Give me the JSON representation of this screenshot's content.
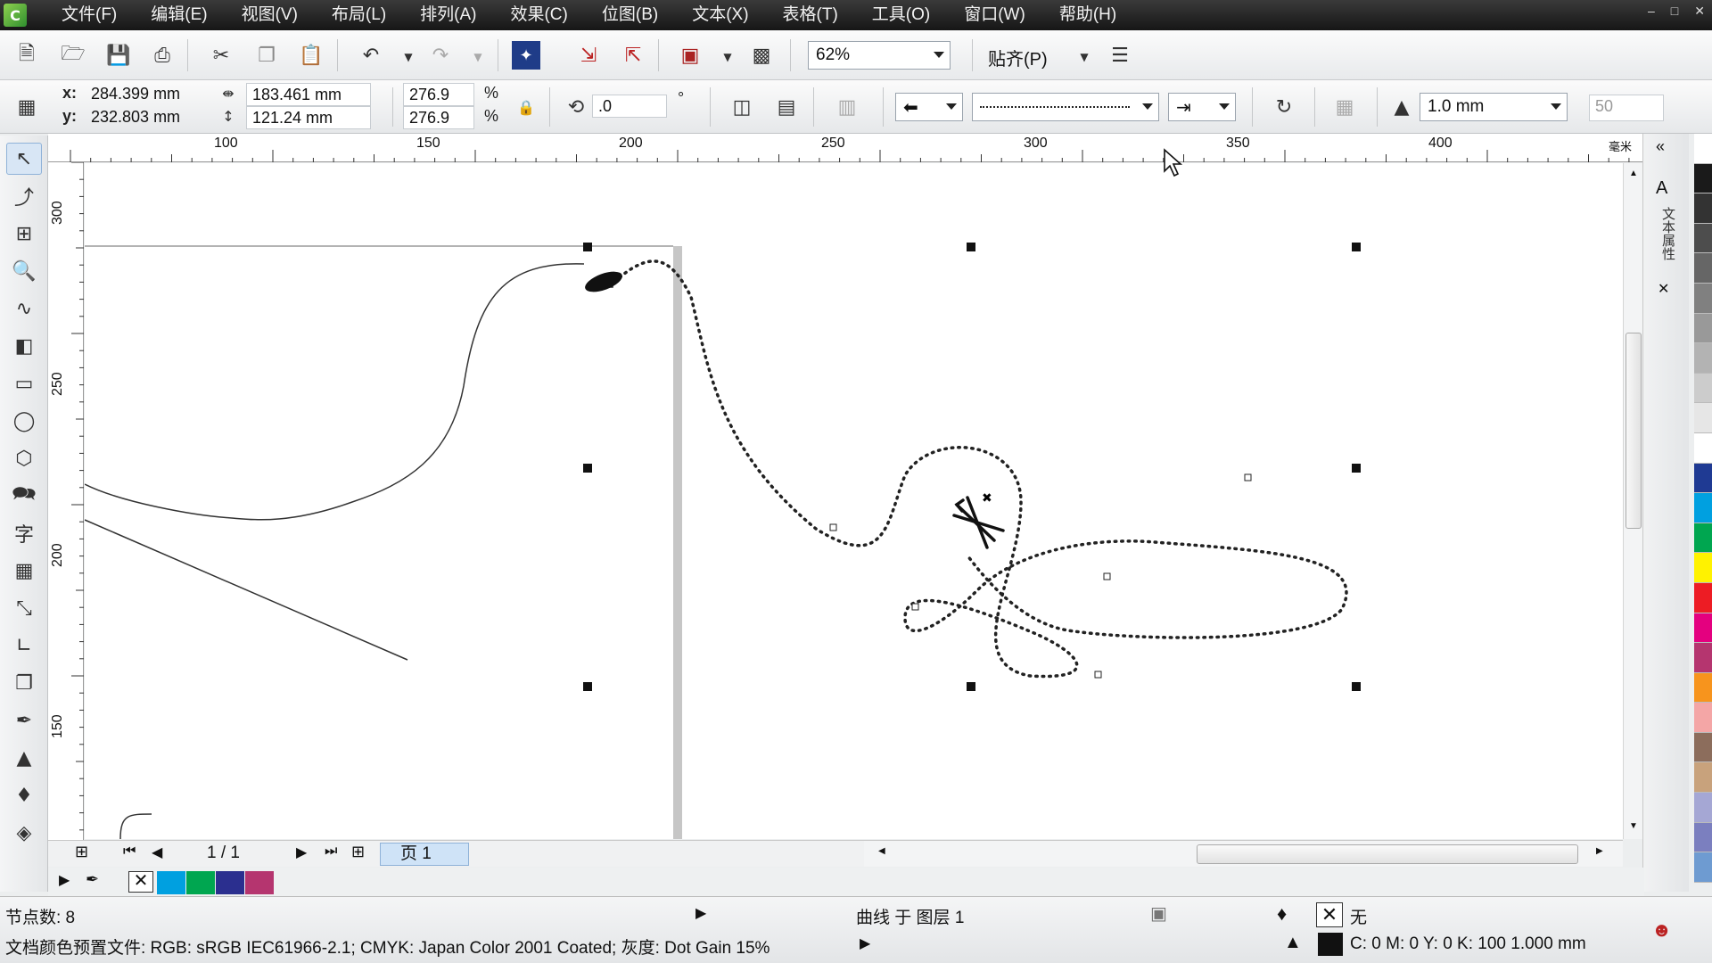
{
  "menu": [
    "文件(F)",
    "编辑(E)",
    "视图(V)",
    "布局(L)",
    "排列(A)",
    "效果(C)",
    "位图(B)",
    "文本(X)",
    "表格(T)",
    "工具(O)",
    "窗口(W)",
    "帮助(H)"
  ],
  "toolbar": {
    "zoom": "62%",
    "snap_label": "贴齐(P)"
  },
  "property_bar": {
    "x": "284.399 mm",
    "y": "232.803 mm",
    "x_label": "x:",
    "y_label": "y:",
    "width": "183.461 mm",
    "height": "121.24 mm",
    "scale_x": "276.9",
    "scale_y": "276.9",
    "percent": "%",
    "rotation": ".0",
    "degree": "°",
    "outline_width": "1.0 mm",
    "extra_value": "50"
  },
  "ruler": {
    "h_labels": [
      "100",
      "150",
      "200",
      "250",
      "300",
      "350",
      "400"
    ],
    "v_labels": [
      "300",
      "250",
      "200",
      "150"
    ],
    "unit": "毫米"
  },
  "docker_title": "文本属性",
  "page_nav": {
    "counter": "1 / 1",
    "page_tab": "页 1"
  },
  "status": {
    "node_count": "节点数: 8",
    "object_info": "曲线 于 图层 1",
    "fill_none": "无",
    "profile": "文档颜色预置文件: RGB: sRGB IEC61966-2.1; CMYK: Japan Color 2001 Coated; 灰度: Dot Gain 15%",
    "outline_info": "C: 0 M: 0 Y: 0 K: 100  1.000 mm"
  },
  "colors": {
    "palette": [
      "#ffffff",
      "#1a1a1a",
      "#333333",
      "#4d4d4d",
      "#666666",
      "#808080",
      "#999999",
      "#b3b3b3",
      "#cccccc",
      "#e6e6e6",
      "#ffffff",
      "#1f3a93",
      "#00a0e0",
      "#00a650",
      "#fff200",
      "#ed1c24",
      "#e4007f",
      "#b5356f",
      "#f7941d",
      "#f4a6a6",
      "#8c6d5c",
      "#c8a27c",
      "#a5a7d4",
      "#7b7fbf",
      "#6e9bd1"
    ],
    "doc_palette": [
      "#00a0e0",
      "#00a650",
      "#2b2f8f",
      "#b5356f"
    ]
  }
}
